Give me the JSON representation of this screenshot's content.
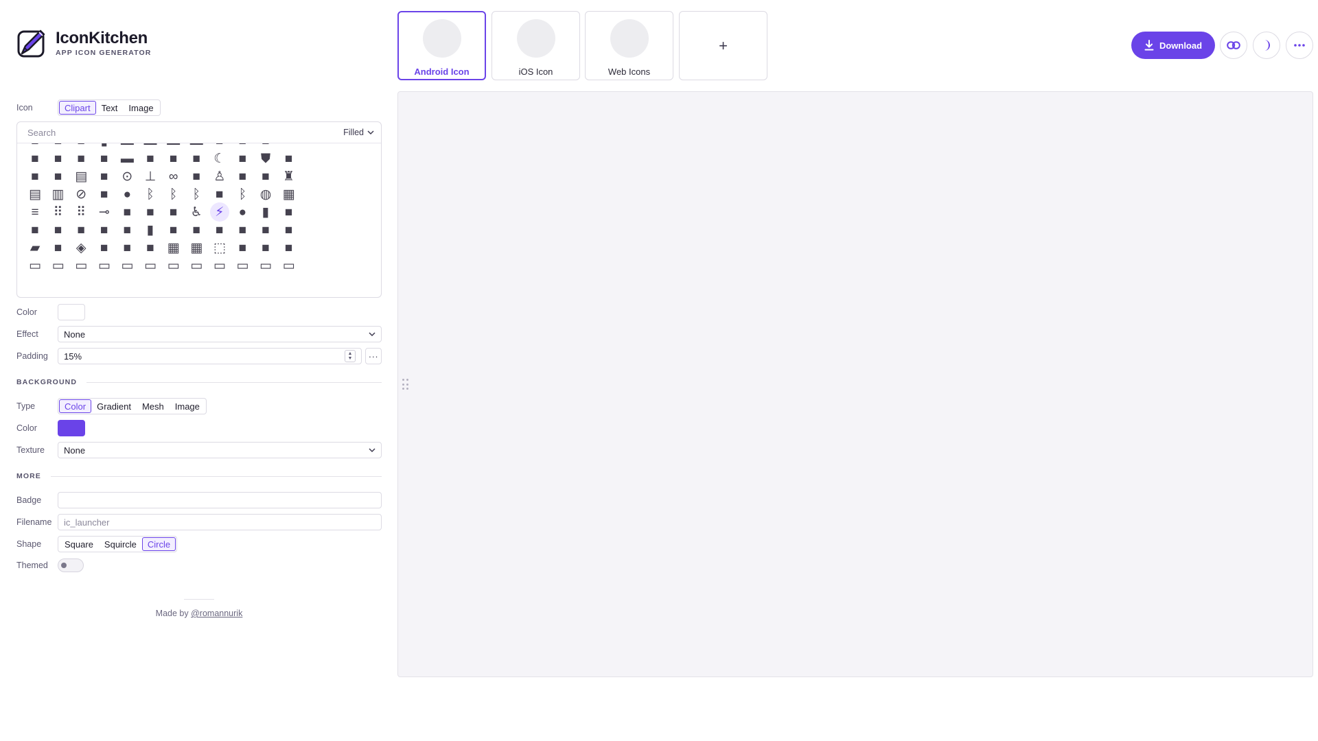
{
  "brand": {
    "name": "IconKitchen",
    "subtitle": "APP ICON GENERATOR"
  },
  "icon_section": {
    "label": "Icon",
    "source_tabs": [
      {
        "label": "Clipart",
        "selected": true
      },
      {
        "label": "Text",
        "selected": false
      },
      {
        "label": "Image",
        "selected": false
      }
    ],
    "search_placeholder": "Search",
    "style_value": "Filled",
    "selected_icon": "bolt-icon",
    "icons": [
      "note-add-icon",
      "note-help-icon",
      "note-remove-icon",
      "file-icon",
      "rect-icon",
      "rect-icon",
      "rect-icon",
      "rect-icon",
      "note-plus-icon",
      "note-settings-icon",
      "note-export-icon",
      "",
      "battery-add-icon",
      "battery-unknown-icon",
      "battery-horizontal-icon",
      "no-signal-icon",
      "bed-icon",
      "bathtub-icon",
      "airline-seat-icon",
      "bed-box-icon",
      "moon-icon",
      "nights-off-icon",
      "shield-check-icon",
      "sync-cloud-icon",
      "dashboard-add-icon",
      "apartment-icon",
      "bar-chart-icon",
      "no-image-icon",
      "antenna-icon",
      "beach-icon",
      "bike-icon",
      "bike-motor-icon",
      "microscope-icon",
      "chat-image-icon",
      "blender-icon",
      "hiker-icon",
      "bars-icon",
      "building-icon",
      "block-icon",
      "sunny-graph-icon",
      "water-drop-icon",
      "bluetooth-icon",
      "bluetooth-connected-icon",
      "bluetooth-off-icon",
      "car-icon",
      "bluetooth-search-icon",
      "blur-circle-icon",
      "grid-icon",
      "speed-icon",
      "blur-off-icon",
      "dots-grid-icon",
      "toggle-off-icon",
      "bus-icon",
      "bus-alert-icon",
      "blast-icon",
      "accessible-icon",
      "bolt-icon",
      "bomb-icon",
      "book-icon",
      "book-open-icon",
      "book-a-icon",
      "book-cover-icon",
      "books-icon",
      "atlas-icon",
      "reading-icon",
      "bookmark-icon",
      "bookmark-add-icon",
      "bookmark-check-icon",
      "bookmark-filled-icon",
      "bookmark-checked-icon",
      "bookmark-flag-icon",
      "bookmark-heart-icon",
      "folder-icon",
      "flag-icon",
      "layers-icon",
      "bookmark-star-icon",
      "bookmarks-icon",
      "book-timer-icon",
      "apps-grid-icon",
      "border-all-icon",
      "border-clear-icon",
      "border-pen-icon",
      "border-h-icon",
      "border-inner-icon",
      "row-icon",
      "row-icon",
      "row-icon",
      "row-icon",
      "row-icon",
      "row-icon",
      "row-icon",
      "row-icon",
      "row-icon",
      "row-icon",
      "row-icon",
      "row-icon"
    ]
  },
  "color": {
    "label": "Color",
    "value": "#ffffff"
  },
  "effect": {
    "label": "Effect",
    "value": "None"
  },
  "padding": {
    "label": "Padding",
    "value": "15%"
  },
  "background": {
    "heading": "BACKGROUND",
    "type_label": "Type",
    "types": [
      {
        "label": "Color",
        "selected": true
      },
      {
        "label": "Gradient",
        "selected": false
      },
      {
        "label": "Mesh",
        "selected": false
      },
      {
        "label": "Image",
        "selected": false
      }
    ],
    "color_label": "Color",
    "color_value": "#6a43e8",
    "texture_label": "Texture",
    "texture_value": "None"
  },
  "more": {
    "heading": "MORE",
    "badge_label": "Badge",
    "badge_value": "",
    "filename_label": "Filename",
    "filename_placeholder": "ic_launcher",
    "shape_label": "Shape",
    "shapes": [
      {
        "label": "Square",
        "selected": false
      },
      {
        "label": "Squircle",
        "selected": false
      },
      {
        "label": "Circle",
        "selected": true
      }
    ],
    "themed_label": "Themed",
    "themed_on": false
  },
  "footer": {
    "prefix": "Made by",
    "handle": "@romannurik"
  },
  "targets": [
    {
      "label": "Android Icon",
      "selected": true
    },
    {
      "label": "iOS Icon",
      "selected": false
    },
    {
      "label": "Web Icons",
      "selected": false
    }
  ],
  "add_target": "+",
  "actions": {
    "download": "Download",
    "link_icon": "link-icon",
    "theme_icon": "half-moon-icon",
    "more_icon": "more-horizontal-icon",
    "accent_color": "#6a43e8"
  }
}
